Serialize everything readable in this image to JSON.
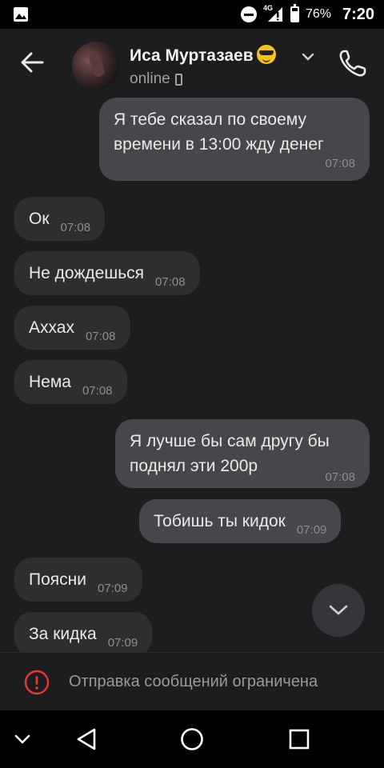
{
  "status_bar": {
    "network": "4G",
    "battery": "76%",
    "time": "7:20",
    "icons": [
      "gallery-icon",
      "do-not-disturb-icon",
      "signal-icon",
      "battery-icon"
    ]
  },
  "header": {
    "contact_name": "Иса Муртазаев",
    "status": "online",
    "icons": [
      "back-arrow-icon",
      "sunglasses-emoji-icon",
      "chevron-down-icon",
      "phone-icon"
    ]
  },
  "messages": [
    {
      "dir": "out",
      "lines": [
        "Я тебе сказал по своему",
        "времени в 13:00 жду денег"
      ],
      "time": "07:08"
    },
    {
      "dir": "in",
      "text": "Ок",
      "time": "07:08"
    },
    {
      "dir": "in",
      "text": "Не дождешься",
      "time": "07:08"
    },
    {
      "dir": "in",
      "text": "Аххах",
      "time": "07:08"
    },
    {
      "dir": "in",
      "text": "Нема",
      "time": "07:08"
    },
    {
      "dir": "out",
      "lines": [
        "Я лучше бы сам другу бы",
        "поднял эти 200р"
      ],
      "time": "07:08"
    },
    {
      "dir": "out",
      "text": "Тобишь ты кидок",
      "time": "07:09"
    },
    {
      "dir": "in",
      "text": "Поясни",
      "time": "07:09"
    },
    {
      "dir": "in",
      "text": "За кидка",
      "time": "07:09"
    }
  ],
  "restriction": {
    "label": "Отправка сообщений ограничена",
    "icon": "warning-icon"
  },
  "colors": {
    "background": "#1d1d1f",
    "incoming_bubble": "#2e2e31",
    "outgoing_bubble": "#47474b",
    "warning": "#e53935"
  },
  "nav_icons": [
    "collapse-icon",
    "back-triangle-icon",
    "home-circle-icon",
    "recents-square-icon"
  ]
}
